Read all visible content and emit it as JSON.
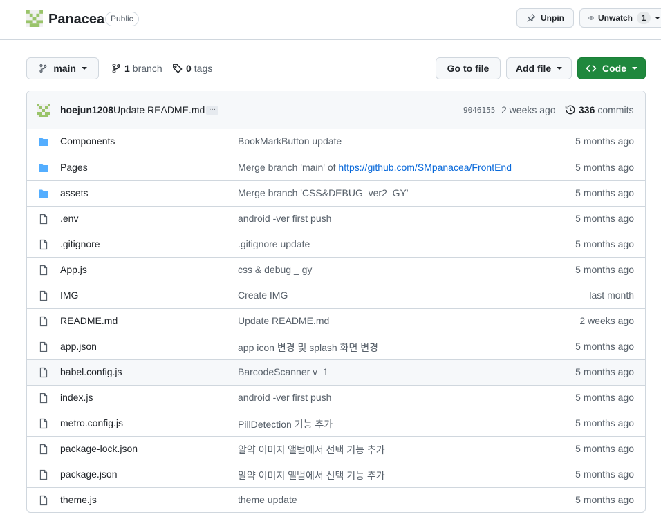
{
  "repo": {
    "name": "Panacea",
    "visibility": "Public",
    "unpin_label": "Unpin",
    "unwatch_label": "Unwatch",
    "watch_count": "1"
  },
  "nav": {
    "branch": "main",
    "branches_count": "1",
    "branches_label": "branch",
    "tags_count": "0",
    "tags_label": "tags",
    "goto_file": "Go to file",
    "add_file": "Add file",
    "code": "Code"
  },
  "commit": {
    "author": "hoejun1208",
    "message": "Update README.md",
    "ellipsis": "…",
    "sha": "9046155",
    "date": "2 weeks ago",
    "count": "336",
    "count_label": "commits"
  },
  "colors": {
    "accent_green": "#1f883d",
    "folder_blue": "#54aeff",
    "link_blue": "#0969da",
    "border": "#d0d7de"
  },
  "files": [
    {
      "name": "Components",
      "type": "folder",
      "msg": "BookMarkButton update",
      "date": "5 months ago"
    },
    {
      "name": "Pages",
      "type": "folder",
      "msg": "Merge branch 'main' of ",
      "msg_link": "https://github.com/SMpanacea/FrontEnd",
      "date": "5 months ago"
    },
    {
      "name": "assets",
      "type": "folder",
      "msg": "Merge branch 'CSS&DEBUG_ver2_GY'",
      "date": "5 months ago"
    },
    {
      "name": ".env",
      "type": "file",
      "msg": "android -ver first push",
      "date": "5 months ago"
    },
    {
      "name": ".gitignore",
      "type": "file",
      "msg": ".gitignore update",
      "date": "5 months ago"
    },
    {
      "name": "App.js",
      "type": "file",
      "msg": "css & debug _ gy",
      "date": "5 months ago"
    },
    {
      "name": "IMG",
      "type": "file",
      "msg": "Create IMG",
      "date": "last month"
    },
    {
      "name": "README.md",
      "type": "file",
      "msg": "Update README.md",
      "date": "2 weeks ago"
    },
    {
      "name": "app.json",
      "type": "file",
      "msg": "app icon 변경 및 splash 화면 변경",
      "date": "5 months ago"
    },
    {
      "name": "babel.config.js",
      "type": "file",
      "msg": "BarcodeScanner v_1",
      "date": "5 months ago"
    },
    {
      "name": "index.js",
      "type": "file",
      "msg": "android -ver first push",
      "date": "5 months ago"
    },
    {
      "name": "metro.config.js",
      "type": "file",
      "msg": "PillDetection 기능 추가",
      "date": "5 months ago"
    },
    {
      "name": "package-lock.json",
      "type": "file",
      "msg": "알약 이미지 앨범에서 선택 기능 추가",
      "date": "5 months ago"
    },
    {
      "name": "package.json",
      "type": "file",
      "msg": "알약 이미지 앨범에서 선택 기능 추가",
      "date": "5 months ago"
    },
    {
      "name": "theme.js",
      "type": "file",
      "msg": "theme update",
      "date": "5 months ago"
    }
  ]
}
